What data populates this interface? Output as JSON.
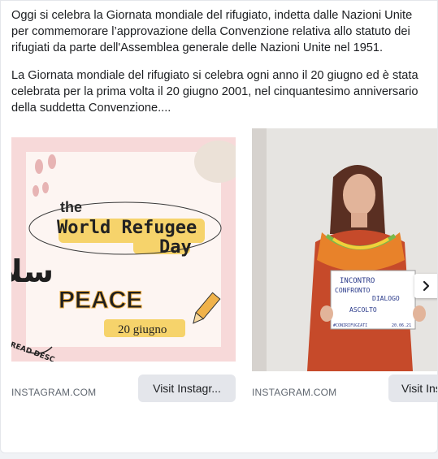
{
  "post": {
    "paragraph1": "Oggi si celebra la Giornata mondiale del rifugiato, indetta dalle Nazioni Unite per commemorare l’approvazione della Convenzione relativa allo statuto dei rifugiati da parte dell'Assemblea generale delle Nazioni Unite nel 1951.",
    "paragraph2": "La Giornata mondiale del rifugiato si celebra ogni anno il 20 giugno ed è stata celebrata per la prima volta il 20 giugno 2001, nel cinquantesimo anniversario della suddetta Convenzione...."
  },
  "carousel": {
    "items": [
      {
        "domain": "INSTAGRAM.COM",
        "button_label": "Visit Instagr...",
        "image": {
          "the": "the",
          "title_line1": "World Refugee",
          "title_line2": "Day",
          "arabic": "سلام",
          "peace": "PEACE",
          "date": "20 giugno",
          "read_desc": "READ DESC"
        }
      },
      {
        "domain": "INSTAGRAM.COM",
        "button_label": "Visit Ins",
        "image": {
          "sign_line1": "INCONTRO",
          "sign_line2": "CONFRONTO",
          "sign_line3": "DIALOGO",
          "sign_line4": "ASCOLTO",
          "sign_footer_left": "#CONIRIFUGIATI",
          "sign_footer_right": "20.06.21"
        }
      }
    ],
    "next_icon": "chevron-right-icon"
  },
  "colors": {
    "text": "#1c1e21",
    "secondary_text": "#606770",
    "button_bg": "#e4e6eb",
    "poster_bg": "#f7d9d9",
    "title_highlight": "#f6d36b",
    "shawl_orange": "#e8822a",
    "dress_red": "#c64a2a"
  }
}
